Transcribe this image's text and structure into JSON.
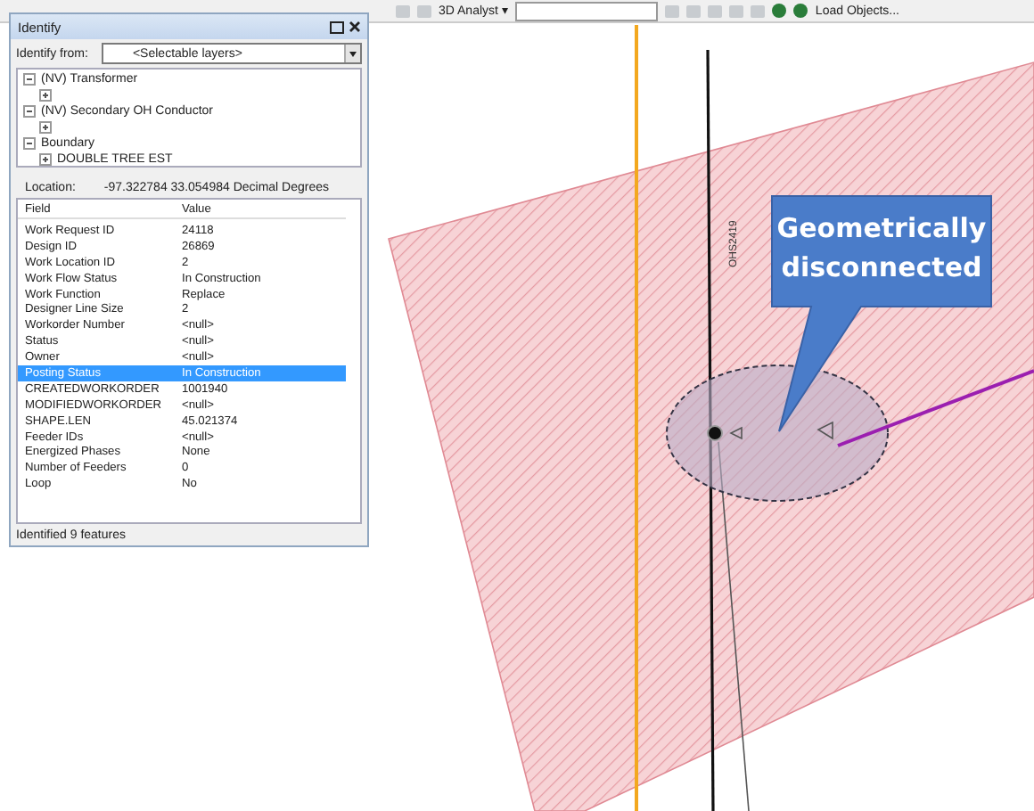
{
  "toolbar": {
    "menu": "3D Analyst",
    "menu_caret": "▾",
    "button": "Load Objects..."
  },
  "identify": {
    "title": "Identify",
    "from_label": "Identify from:",
    "from_value": "<Selectable layers>",
    "tree": [
      {
        "label": "(NV) Transformer",
        "expanded": true,
        "children": [
          {
            "expanded": false
          }
        ]
      },
      {
        "label": "(NV) Secondary OH Conductor",
        "expanded": true,
        "children": [
          {
            "expanded": false
          }
        ]
      },
      {
        "label": "Boundary",
        "expanded": true,
        "children": [
          {
            "label": "DOUBLE TREE EST",
            "expanded": false
          }
        ]
      }
    ],
    "location_label": "Location:",
    "location_value": "-97.322784  33.054984 Decimal Degrees",
    "columns": [
      "Field",
      "Value"
    ],
    "rows": [
      {
        "field": "Work Request ID",
        "value": "24118",
        "selected": false
      },
      {
        "field": "Design ID",
        "value": "26869",
        "selected": false
      },
      {
        "field": "Work Location ID",
        "value": "2",
        "selected": false
      },
      {
        "field": "Work Flow Status",
        "value": "In Construction",
        "selected": false
      },
      {
        "field": "Work Function",
        "value": "Replace",
        "selected": false
      },
      {
        "field": "Designer Line Size",
        "value": "2",
        "selected": false
      },
      {
        "field": "Workorder Number",
        "value": "<null>",
        "selected": false
      },
      {
        "field": "Status",
        "value": "<null>",
        "selected": false
      },
      {
        "field": "Owner",
        "value": "<null>",
        "selected": false
      },
      {
        "field": "Posting Status",
        "value": "In Construction",
        "selected": true
      },
      {
        "field": "CREATEDWORKORDER",
        "value": "1001940",
        "selected": false
      },
      {
        "field": "MODIFIEDWORKORDER",
        "value": "<null>",
        "selected": false
      },
      {
        "field": "SHAPE.LEN",
        "value": "45.021374",
        "selected": false
      },
      {
        "field": "Feeder IDs",
        "value": "<null>",
        "selected": false
      },
      {
        "field": "Energized Phases",
        "value": "None",
        "selected": false
      },
      {
        "field": "Number of Feeders",
        "value": "0",
        "selected": false
      },
      {
        "field": "Loop",
        "value": "No",
        "selected": false
      }
    ],
    "status": "Identified 9 features"
  },
  "map": {
    "line_label": "OHS2419",
    "callout": "Geometrically disconnected"
  }
}
